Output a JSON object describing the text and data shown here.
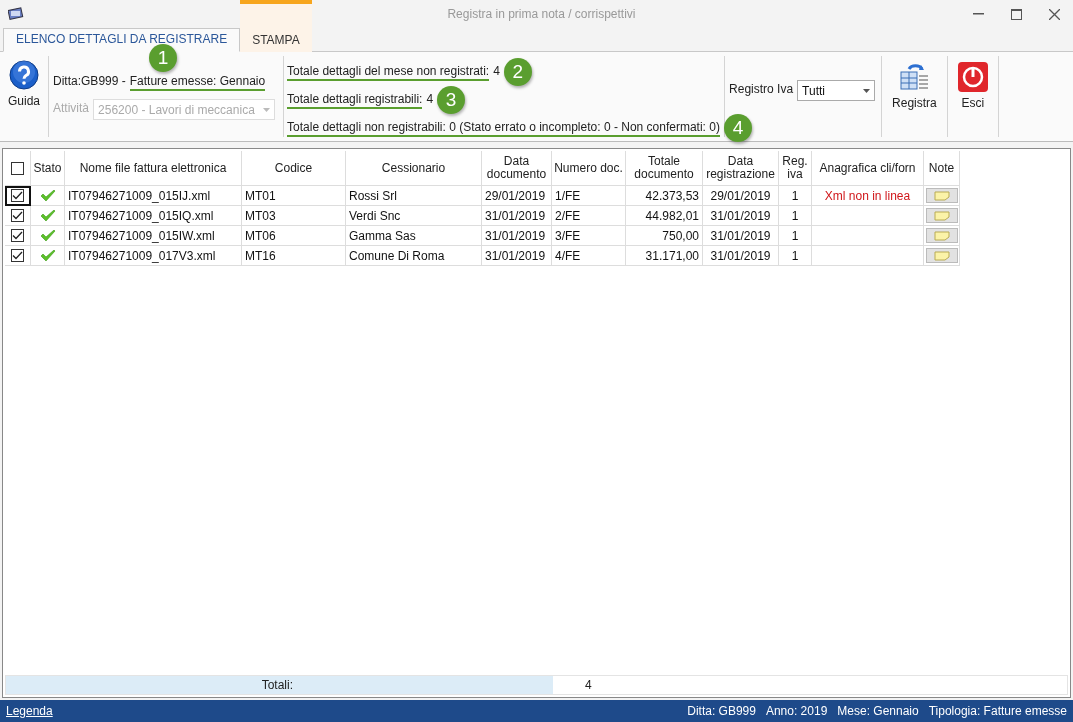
{
  "window": {
    "title": "Registra in prima nota / corrispettivi"
  },
  "tabs": [
    {
      "label": "ELENCO DETTAGLI DA REGISTRARE",
      "selected": true,
      "accent": false
    },
    {
      "label": "STAMPA",
      "selected": false,
      "accent": true
    }
  ],
  "ribbon": {
    "help_button": "Guida",
    "ditta": [
      {
        "text": "Ditta:GB999 -",
        "highlighted": false
      },
      {
        "text": "Fatture emesse: Gennaio",
        "highlighted": true
      }
    ],
    "attivita": {
      "label": "Attività",
      "value": "256200 - Lavori di meccanica",
      "disabled": true
    },
    "totals": [
      {
        "label": "Totale dettagli del mese non registrati:",
        "value": "4",
        "callout": "2"
      },
      {
        "label": "Totale dettagli registrabili:",
        "value": "4",
        "callout": "3"
      },
      {
        "label": "Totale dettagli non registrabili: 0 (Stato errato o incompleto: 0 - Non confermati: 0)",
        "callout": "4"
      }
    ],
    "ditta_callout": "1",
    "registro_iva": {
      "label": "Registro Iva",
      "value": "Tutti"
    },
    "buttons": [
      {
        "kind": "registra",
        "label": "Registra"
      },
      {
        "kind": "exit",
        "label": "Esci"
      }
    ]
  },
  "table": {
    "header_checked": false,
    "columns": [
      "Stato",
      "Nome file fattura elettronica",
      "Codice",
      "Cessionario",
      "Data documento",
      "Numero doc.",
      "Totale documento",
      "Data registrazione",
      "Reg. iva",
      "Anagrafica cli/forn",
      "Note"
    ],
    "rows": [
      {
        "checked": true,
        "focused": true,
        "valid": true,
        "file": "IT07946271009_015IJ.xml",
        "codice": "MT01",
        "cessionario": "Rossi Srl",
        "data_documento": "29/01/2019",
        "numero": "1/FE",
        "totale": "42.373,53",
        "data_registrazione": "29/01/2019",
        "reg_iva": "1",
        "anagrafica": "Xml non in linea"
      },
      {
        "checked": true,
        "focused": false,
        "valid": true,
        "file": "IT07946271009_015IQ.xml",
        "codice": "MT03",
        "cessionario": "Verdi Snc",
        "data_documento": "31/01/2019",
        "numero": "2/FE",
        "totale": "44.982,01",
        "data_registrazione": "31/01/2019",
        "reg_iva": "1"
      },
      {
        "checked": true,
        "focused": false,
        "valid": true,
        "file": "IT07946271009_015IW.xml",
        "codice": "MT06",
        "cessionario": "Gamma Sas",
        "data_documento": "31/01/2019",
        "numero": "3/FE",
        "totale": "750,00",
        "data_registrazione": "31/01/2019",
        "reg_iva": "1"
      },
      {
        "checked": true,
        "focused": false,
        "valid": true,
        "file": "IT07946271009_017V3.xml",
        "codice": "MT16",
        "cessionario": "Comune Di Roma",
        "data_documento": "31/01/2019",
        "numero": "4/FE",
        "totale": "31.171,00",
        "data_registrazione": "31/01/2019",
        "reg_iva": "1"
      }
    ],
    "footer": {
      "label": "Totali:",
      "value": "4"
    }
  },
  "status_bar": {
    "link": "Legenda",
    "items": [
      "Ditta: GB999",
      "Anno: 2019",
      "Mese: Gennaio",
      "Tipologia: Fatture emesse"
    ]
  }
}
